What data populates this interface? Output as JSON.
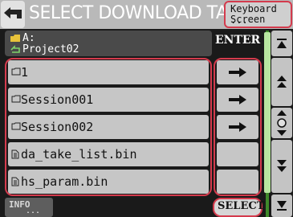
{
  "title": "SELECT DOWNLOAD TARGET",
  "keyboard_button": {
    "line1": "Keyboard",
    "line2": "Screen",
    "dots": "..."
  },
  "current_folder": {
    "drive": "A:",
    "name": "Project02"
  },
  "enter_header": "ENTER",
  "rows": [
    {
      "label": "1",
      "icon": "folder-icon",
      "enterable": true
    },
    {
      "label": "Session001",
      "icon": "folder-icon",
      "enterable": true
    },
    {
      "label": "Session002",
      "icon": "folder-icon",
      "enterable": true
    },
    {
      "label": "da_take_list.bin",
      "icon": "file-icon",
      "enterable": false
    },
    {
      "label": "hs_param.bin",
      "icon": "file-icon",
      "enterable": false
    }
  ],
  "info_button": {
    "label": "INFO",
    "dots": "..."
  },
  "select_button": "SELECT",
  "colors": {
    "highlight": "#d43b4d",
    "row_bg": "#c6c6c6",
    "scroll_green": "#3f8a2a"
  }
}
